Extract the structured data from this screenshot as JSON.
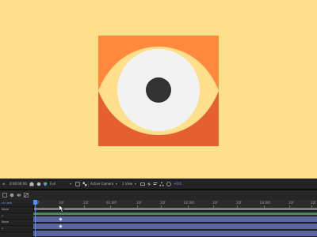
{
  "viewer": {
    "colors": {
      "background": "#fedf8c",
      "square_top": "#ff8a3d",
      "square_bottom": "#e55f2f",
      "eye_white_outer": "#fedf8c",
      "iris": "#f2f2f2",
      "pupil": "#333333"
    }
  },
  "viewer_toolbar": {
    "timecode": "0:00:00:00",
    "resolution": "Full",
    "camera": "Active Camera",
    "views": "1 View",
    "exposure": "+0.0"
  },
  "timeline": {
    "ruler_labels": [
      "00f",
      "10f",
      "20f",
      "01:00f",
      "10f",
      "20f",
      "02:00f",
      "10f",
      "20f",
      "03:00f",
      "10f",
      "20f"
    ],
    "layers": [
      {
        "name": "ck Lock",
        "mode": ""
      },
      {
        "name": "None",
        "mode": ""
      },
      {
        "name": "ll",
        "mode": ""
      },
      {
        "name": "None",
        "mode": ""
      },
      {
        "name": "ll",
        "mode": ""
      }
    ]
  }
}
